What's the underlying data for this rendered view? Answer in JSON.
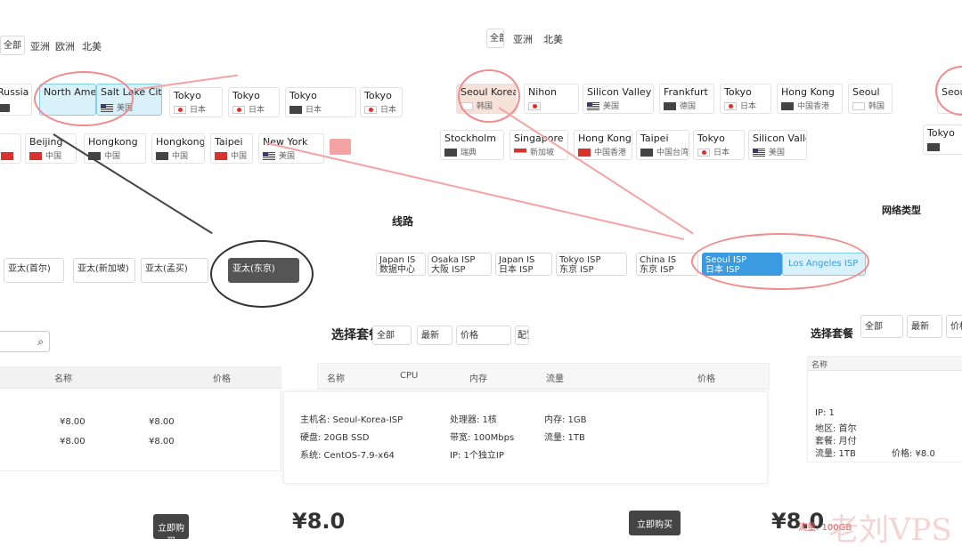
{
  "left_panel": {
    "tabs": [
      "全部",
      "亚洲",
      "欧洲",
      "北美"
    ],
    "row1": [
      {
        "name": "Russia",
        "sub": "A",
        "flag": "dark"
      },
      {
        "name": "North America",
        "sub": "",
        "flag": "us",
        "highlight": true
      },
      {
        "name": "Salt Lake City",
        "sub": "美国",
        "flag": "us",
        "highlight": true
      },
      {
        "name": "Tokyo",
        "sub": "日本",
        "flag": "jp"
      },
      {
        "name": "Tokyo",
        "sub": "日本",
        "flag": "jp"
      },
      {
        "name": "Tokyo",
        "sub": "日本",
        "flag": "dark"
      },
      {
        "name": "Tokyo",
        "sub": "日本",
        "flag": "jp"
      }
    ],
    "row2": [
      {
        "name": "Beijing",
        "sub": "中国",
        "flag": "cn"
      },
      {
        "name": "Hongkong",
        "sub": "中国",
        "flag": "dark"
      },
      {
        "name": "Hongkong",
        "sub": "中国",
        "flag": "dark"
      },
      {
        "name": "Taipei",
        "sub": "中国",
        "flag": "cn"
      },
      {
        "name": "New York",
        "sub": "美国",
        "flag": "us"
      }
    ],
    "row3": [
      "亚太(首尔)",
      "亚太(新加坡)",
      "亚太(孟买)",
      "亚太(东京)"
    ]
  },
  "right_panel": {
    "tabs": [
      "全部",
      "亚洲",
      "北美"
    ],
    "row1": [
      {
        "name": "Seoul Korea",
        "sub": "韩国",
        "flag": "kr",
        "active": true
      },
      {
        "name": "Nihon",
        "sub": "日本",
        "flag": "jp"
      },
      {
        "name": "Silicon Valley",
        "sub": "美国",
        "flag": "us"
      },
      {
        "name": "Frankfurt",
        "sub": "德国",
        "flag": "dark"
      },
      {
        "name": "Tokyo",
        "sub": "日本",
        "flag": "jp"
      },
      {
        "name": "Hong Kong",
        "sub": "中国香港",
        "flag": "dark"
      },
      {
        "name": "Seoul",
        "sub": "韩国",
        "flag": "kr"
      },
      {
        "name": "Seoul",
        "sub": "韩国",
        "flag": "kr"
      }
    ],
    "row2": [
      {
        "name": "Stockholm",
        "sub": "瑞典",
        "flag": "dark"
      },
      {
        "name": "Singapore",
        "sub": "新加坡",
        "flag": "sg"
      },
      {
        "name": "Hong Kong",
        "sub": "中国香港",
        "flag": "cn"
      },
      {
        "name": "Taipei",
        "sub": "中国台湾",
        "flag": "dark"
      },
      {
        "name": "Tokyo",
        "sub": "日本",
        "flag": "jp"
      },
      {
        "name": "Silicon Valley",
        "sub": "美国",
        "flag": "us"
      },
      {
        "name": "Tokyo",
        "sub": "日本",
        "flag": "dark"
      }
    ],
    "label": "线路",
    "lines": [
      "Japan IS",
      "Osaka ISP",
      "Japan IS",
      "Tokyo ISP",
      "China IS",
      "Seoul ISP",
      "Los Angeles ISP"
    ],
    "lines_sub": [
      "数据中心",
      "大阪 ISP",
      "日本 ISP",
      "东京 ISP",
      "东京 ISP",
      "日本 ISP",
      "美国 ISP"
    ],
    "side_label": "网络类型"
  },
  "plans": {
    "title": "选择套餐",
    "filters": [
      "全部",
      "最新",
      "价格",
      "配置"
    ],
    "right_title": "选择套餐",
    "right_filters": [
      "全部",
      "最新",
      "价格"
    ],
    "headers": [
      "名称",
      "CPU",
      "内存",
      "流量",
      "价格"
    ],
    "detail_lines": [
      "主机名: Seoul-Korea-ISP",
      "处理器: 1核",
      "内存: 1GB",
      "硬盘: 20GB SSD",
      "带宽: 100Mbps",
      "流量: 1TB",
      "系统: CentOS-7.9-x64",
      "IP: 1个独立IP"
    ],
    "left_table_cells": [
      "¥8.00",
      "¥8.00",
      "¥8.00",
      "¥8.00"
    ],
    "right_table_cells": [
      "IP: 1",
      "地区: 首尔",
      "套餐: 月付",
      "流量: 1TB",
      "价格: ¥8.0"
    ],
    "price_left": "¥8.0",
    "price_right": "¥8.0",
    "buy_label": "立即购买",
    "buy_label_2": "立即购买",
    "price_note": "流量: 100GB"
  },
  "watermark": "老刘VPS"
}
